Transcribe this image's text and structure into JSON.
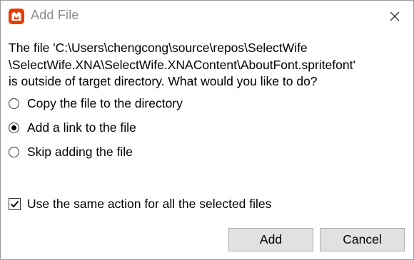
{
  "window": {
    "title": "Add File",
    "app_icon": "monogame-icon",
    "close_icon": "close-icon",
    "accent_color": "#e73c00"
  },
  "message": {
    "lines": [
      "The file 'C:\\Users\\chengcong\\source\\repos\\SelectWife",
      "\\SelectWife.XNA\\SelectWife.XNAContent\\AboutFont.spritefont'",
      "is outside of target directory. What would you like to do?"
    ]
  },
  "options": [
    {
      "label": "Copy the file to the directory",
      "selected": false
    },
    {
      "label": "Add a link to the file",
      "selected": true
    },
    {
      "label": "Skip adding the file",
      "selected": false
    }
  ],
  "apply_all": {
    "label": "Use the same action for all the selected files",
    "checked": true
  },
  "buttons": {
    "add_label": "Add",
    "cancel_label": "Cancel"
  }
}
